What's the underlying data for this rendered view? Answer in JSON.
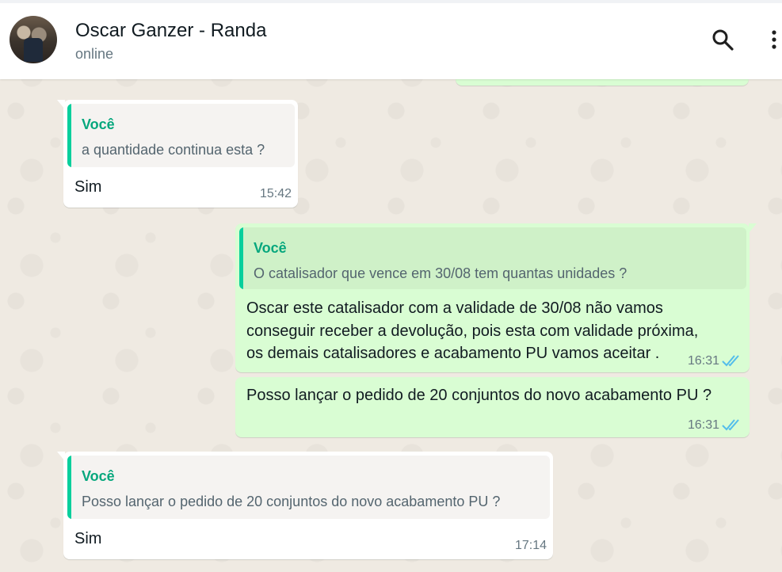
{
  "contact": {
    "name": "Oscar Ganzer - Randa",
    "status": "online"
  },
  "icons": {
    "search": "search-icon",
    "menu": "menu-icon",
    "read_receipt": "double-check-icon"
  },
  "colors": {
    "incoming_bubble": "#ffffff",
    "outgoing_bubble": "#d9fdd3",
    "quote_accent": "#06cf9c",
    "read_tick": "#53bdeb"
  },
  "messages": [
    {
      "direction": "incoming",
      "quote_author": "Você",
      "quote_text": "a quantidade continua esta ?",
      "text": "Sim",
      "time": "15:42"
    },
    {
      "direction": "outgoing",
      "quote_author": "Você",
      "quote_text": "O catalisador que vence em 30/08 tem quantas unidades ?",
      "text_lines": [
        "Oscar este catalisador com a validade de 30/08 não vamos",
        "conseguir receber a devolução, pois esta com validade próxima,",
        "os demais catalisadores e acabamento PU vamos aceitar ."
      ],
      "time": "16:31",
      "status": "read"
    },
    {
      "direction": "outgoing",
      "text": "Posso lançar o pedido de 20 conjuntos do novo acabamento PU ?",
      "time": "16:31",
      "status": "read"
    },
    {
      "direction": "incoming",
      "quote_author": "Você",
      "quote_text": "Posso lançar o pedido de 20 conjuntos do novo acabamento PU ?",
      "text": "Sim",
      "time": "17:14"
    }
  ]
}
